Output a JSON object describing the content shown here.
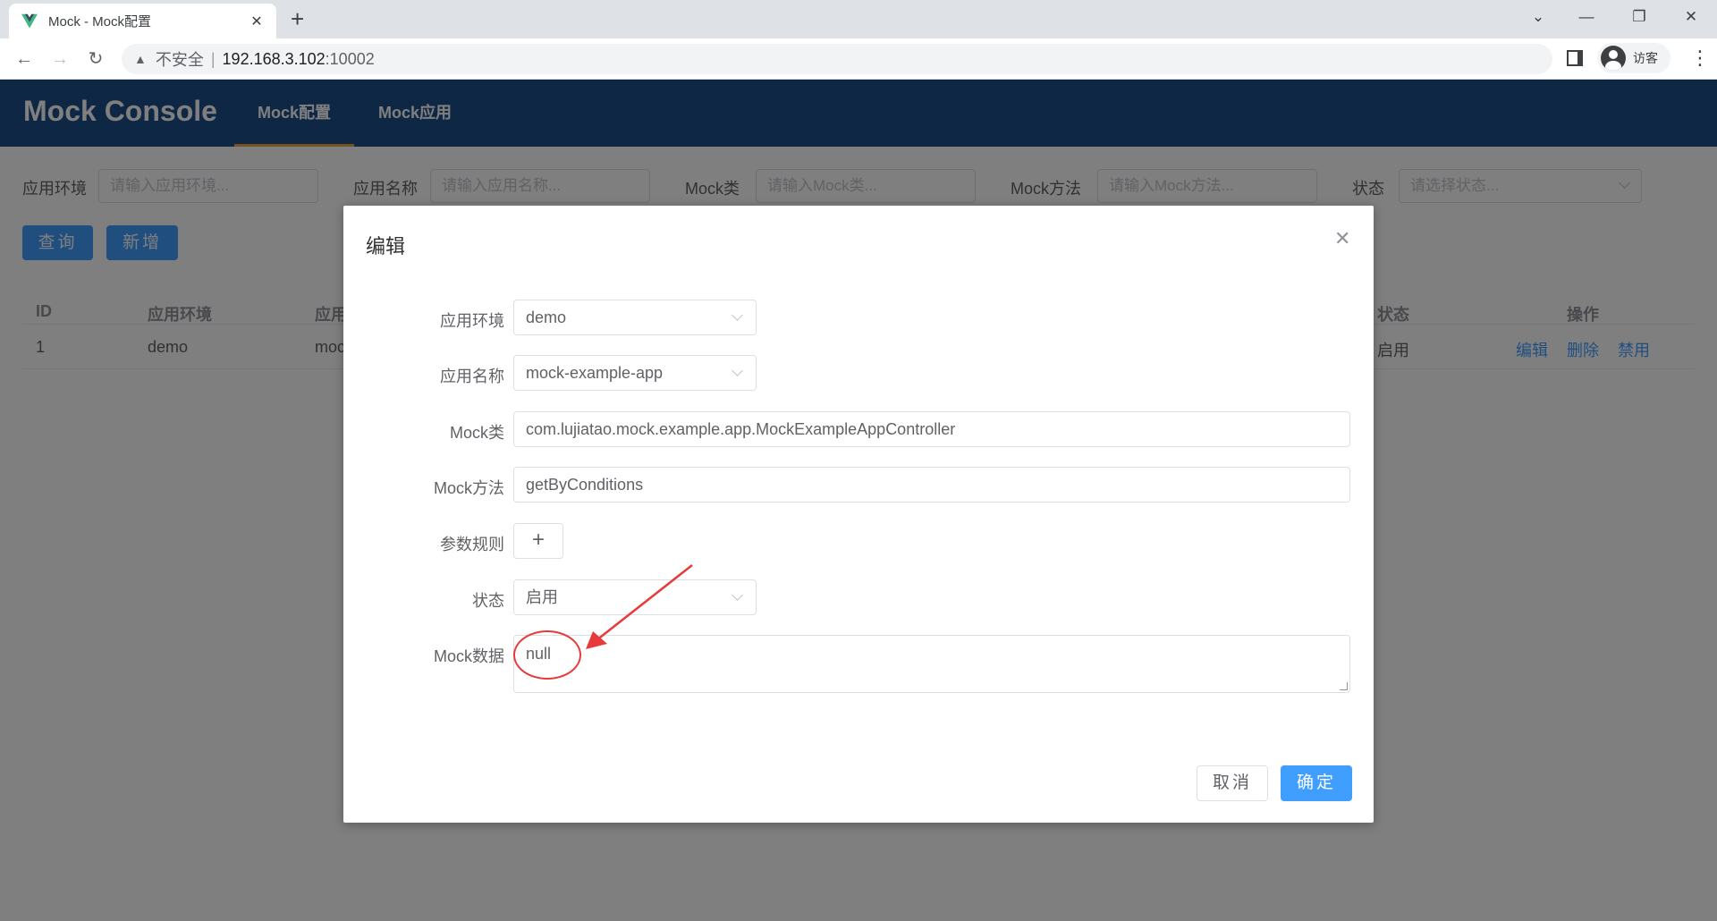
{
  "browser": {
    "tab_title": "Mock - Mock配置",
    "address_insecure": "不安全",
    "address_host": "192.168.3.102",
    "address_port": ":10002",
    "profile_label": "访客"
  },
  "header": {
    "title": "Mock Console",
    "nav": [
      {
        "label": "Mock配置",
        "active": true
      },
      {
        "label": "Mock应用",
        "active": false
      }
    ]
  },
  "filters": {
    "env_label": "应用环境",
    "env_placeholder": "请输入应用环境...",
    "app_label": "应用名称",
    "app_placeholder": "请输入应用名称...",
    "class_label": "Mock类",
    "class_placeholder": "请输入Mock类...",
    "method_label": "Mock方法",
    "method_placeholder": "请输入Mock方法...",
    "status_label": "状态",
    "status_placeholder": "请选择状态..."
  },
  "actions": {
    "query_label": "查询",
    "add_label": "新增"
  },
  "table": {
    "headers": [
      "ID",
      "应用环境",
      "应用",
      "状态",
      "操作"
    ],
    "rows": [
      {
        "id": "1",
        "env": "demo",
        "app": "moc",
        "status": "启用",
        "ops": [
          "编辑",
          "删除",
          "禁用"
        ]
      }
    ]
  },
  "dialog": {
    "title": "编辑",
    "fields": {
      "env_label": "应用环境",
      "env_value": "demo",
      "app_label": "应用名称",
      "app_value": "mock-example-app",
      "class_label": "Mock类",
      "class_value": "com.lujiatao.mock.example.app.MockExampleAppController",
      "method_label": "Mock方法",
      "method_value": "getByConditions",
      "params_label": "参数规则",
      "params_add": "+",
      "status_label": "状态",
      "status_value": "启用",
      "data_label": "Mock数据",
      "data_value": "null"
    },
    "cancel_label": "取消",
    "ok_label": "确定"
  },
  "colors": {
    "header_bg": "#1c4f8b",
    "primary": "#409eff",
    "annotation": "#e83a3a"
  }
}
